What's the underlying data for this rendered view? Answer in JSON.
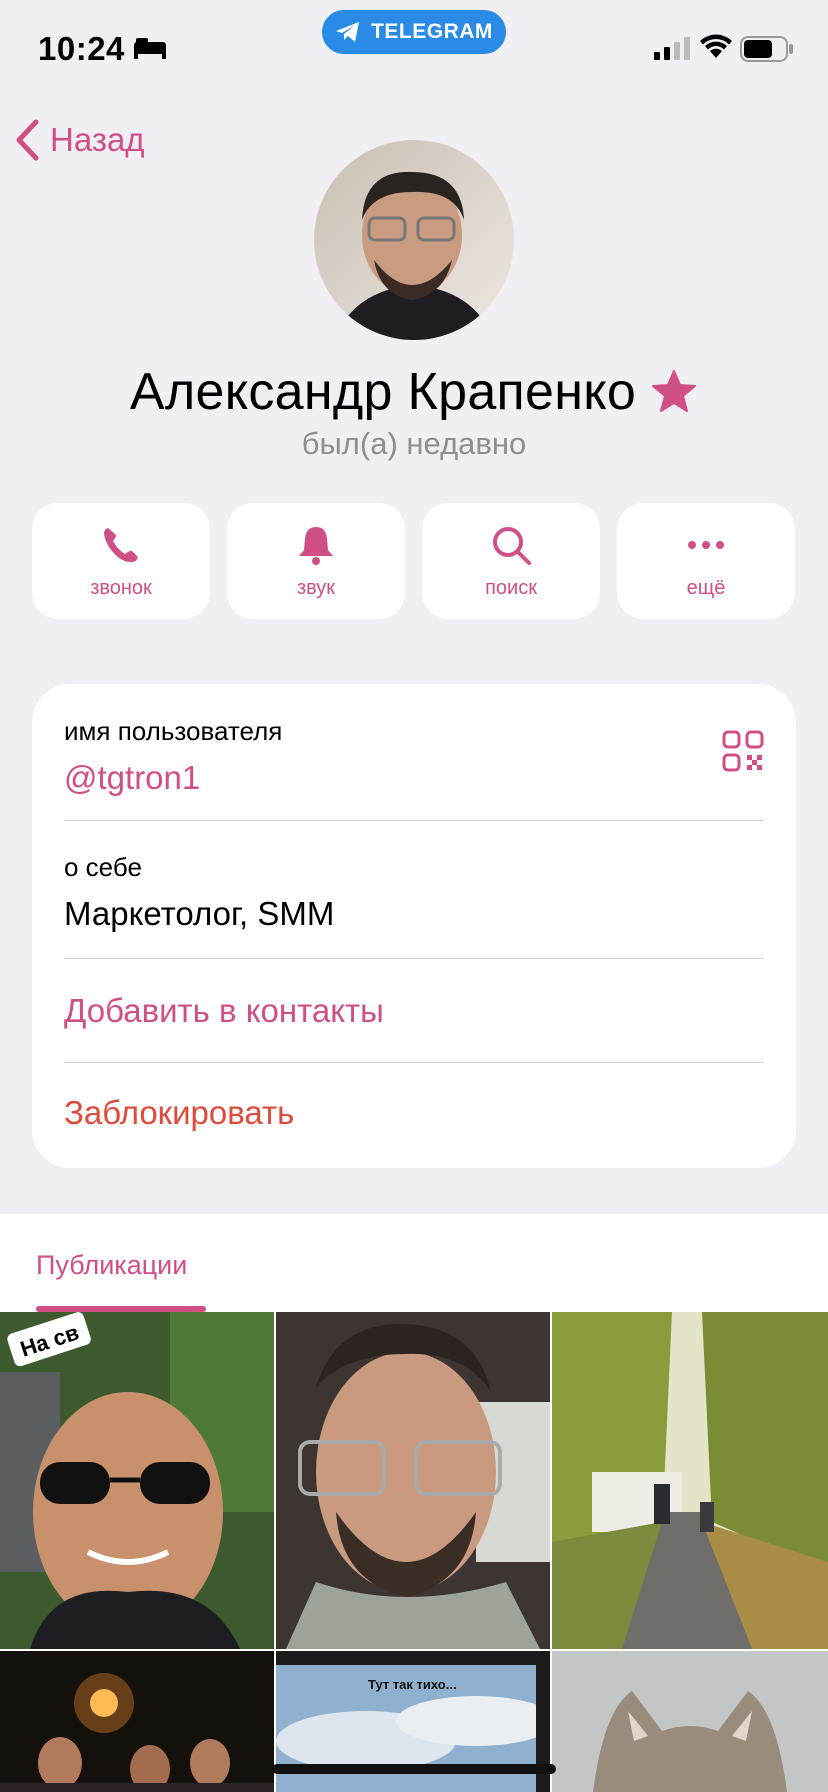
{
  "status_bar": {
    "time": "10:24",
    "app_pill": "TELEGRAM"
  },
  "nav": {
    "back_label": "Назад"
  },
  "profile": {
    "name": "Александр Крапенко",
    "status": "был(а) недавно",
    "accent_color": "#d04f87"
  },
  "actions": [
    {
      "label": "звонок",
      "icon": "phone-icon"
    },
    {
      "label": "звук",
      "icon": "bell-icon"
    },
    {
      "label": "поиск",
      "icon": "search-icon"
    },
    {
      "label": "ещё",
      "icon": "more-icon"
    }
  ],
  "info": {
    "username_label": "имя пользователя",
    "username": "@tgtron1",
    "about_label": "о себе",
    "about": "Маркетолог, SMM",
    "add_contact": "Добавить в контакты",
    "block": "Заблокировать",
    "block_color": "#e04a3a"
  },
  "publications": {
    "tab_label": "Публикации",
    "tile_texts": [
      "На св",
      "Тут так тихо..."
    ]
  }
}
